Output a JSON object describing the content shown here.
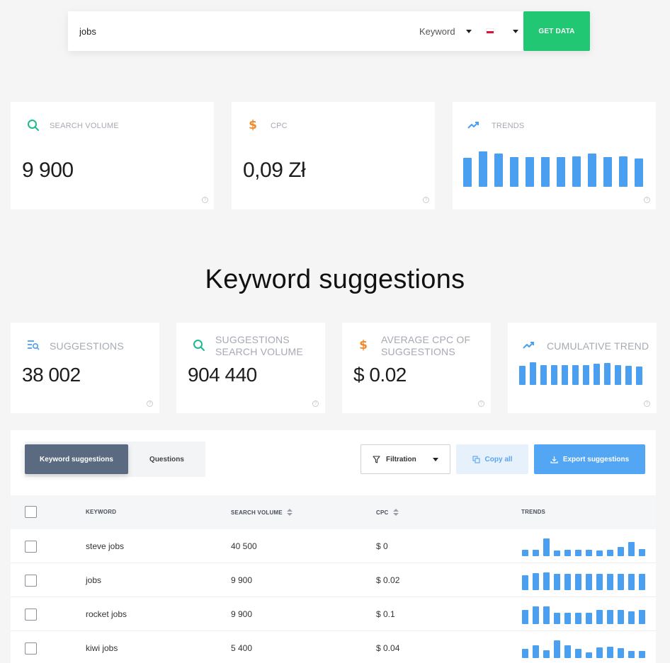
{
  "search": {
    "query": "jobs",
    "type_label": "Keyword",
    "country_flag": "pl-flag-icon",
    "button_label": "GET DATA"
  },
  "metrics": {
    "search_volume": {
      "label": "SEARCH VOLUME",
      "value": "9 900",
      "icon": "search-icon"
    },
    "cpc": {
      "label": "CPC",
      "value": "0,09 Zł",
      "icon": "dollar-icon"
    },
    "trends": {
      "label": "TRENDS",
      "icon": "trend-up-icon",
      "values": [
        0.82,
        1.0,
        0.93,
        0.83,
        0.83,
        0.83,
        0.83,
        0.86,
        0.93,
        0.83,
        0.86,
        0.79
      ]
    }
  },
  "section_title": "Keyword suggestions",
  "summary": {
    "suggestions": {
      "label": "SUGGESTIONS",
      "value": "38 002",
      "icon": "list-search-icon"
    },
    "suggestions_volume": {
      "label_line1": "SUGGESTIONS",
      "label_line2": "SEARCH VOLUME",
      "value": "904 440",
      "icon": "search-icon"
    },
    "avg_cpc": {
      "label_line1": "AVERAGE CPC OF",
      "label_line2": "SUGGESTIONS",
      "value": "$ 0.02",
      "icon": "dollar-icon"
    },
    "cumulative_trend": {
      "label": "CUMULATIVE TREND",
      "icon": "trend-up-icon",
      "values": [
        0.85,
        1.0,
        0.87,
        0.87,
        0.87,
        0.87,
        0.87,
        0.93,
        0.96,
        0.87,
        0.84,
        0.82
      ]
    }
  },
  "toolbar": {
    "tab_keywords": "Keyword suggestions",
    "tab_questions": "Questions",
    "filter_label": "Filtration",
    "copy_label": "Copy all",
    "export_label": "Export suggestions"
  },
  "table": {
    "columns": [
      "KEYWORD",
      "SEARCH VOLUME",
      "CPC",
      "TRENDS"
    ],
    "rows": [
      {
        "keyword": "steve jobs",
        "volume": "40 500",
        "cpc": "$ 0",
        "trend": [
          0.35,
          0.35,
          1.0,
          0.3,
          0.35,
          0.35,
          0.35,
          0.3,
          0.35,
          0.5,
          0.8,
          0.4
        ]
      },
      {
        "keyword": "jobs",
        "volume": "9 900",
        "cpc": "$ 0.02",
        "trend": [
          0.85,
          0.95,
          1.0,
          0.9,
          0.9,
          0.9,
          0.9,
          0.9,
          0.9,
          0.9,
          0.9,
          0.9
        ]
      },
      {
        "keyword": "rocket jobs",
        "volume": "9 900",
        "cpc": "$ 0.1",
        "trend": [
          0.8,
          1.0,
          1.0,
          0.65,
          0.65,
          0.65,
          0.65,
          0.8,
          0.8,
          0.8,
          0.7,
          0.8
        ]
      },
      {
        "keyword": "kiwi jobs",
        "volume": "5 400",
        "cpc": "$ 0.04",
        "trend": [
          0.5,
          0.7,
          0.45,
          1.0,
          0.7,
          0.5,
          0.3,
          0.6,
          0.65,
          0.55,
          0.4,
          0.4
        ]
      }
    ]
  },
  "colors": {
    "accent_green": "#22c773",
    "bar_blue": "#4a9ff0",
    "dollar_orange": "#f08a2c",
    "search_teal": "#1abc8f"
  }
}
